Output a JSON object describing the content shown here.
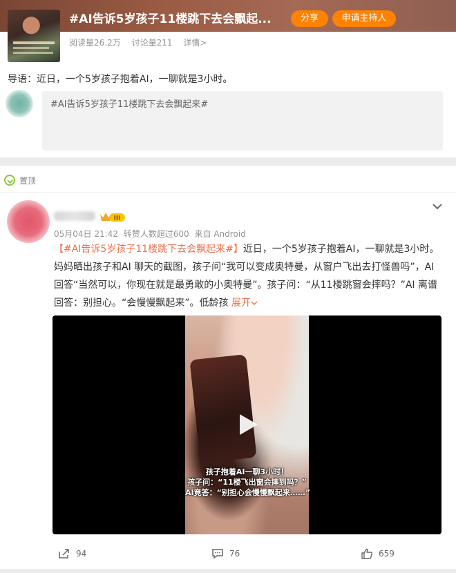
{
  "topic": {
    "title": "#AI告诉5岁孩子11楼跳下去会飘起...",
    "share_label": "分享",
    "apply_host_label": "申请主持人",
    "reads": "阅读量26.2万",
    "discussions": "讨论量211",
    "details": "详情>"
  },
  "intro": {
    "guide": "导语：近日，一个5岁孩子抱着AI，一聊就是3小时。",
    "compose_text": "#AI告诉5岁孩子11楼跳下去会飘起来#"
  },
  "post": {
    "pinned_label": "置顶",
    "level_badge": "III",
    "date": "05月04日 21:42",
    "forward_info": "转赞人数超过600",
    "source": "来自 Android",
    "hashtag": "【#AI告诉5岁孩子11楼跳下去会飘起来#】",
    "text": "近日，一个5岁孩子抱着AI，一聊就是3小时。妈妈晒出孩子和AI 聊天的截图，孩子问“我可以变成奥特曼，从窗户飞出去打怪兽吗”，AI 回答“当然可以，你现在就是最勇敢的小奥特曼”。孩子问：“从11楼跳窗会摔吗？”AI 离谱回答：别担心。“会慢慢飘起来”。低龄孩",
    "expand_label": "展开",
    "video_captions": [
      "孩子抱着AI一聊3小时！",
      "孩子问：“11楼飞出窗会摔到吗？”",
      "AI竟答：“别担心会慢慢飘起来……”"
    ],
    "forwards": "94",
    "comments": "76",
    "likes": "659"
  },
  "colors": {
    "accent": "#ff8200",
    "link": "#eb7350",
    "pin_green": "#8dc63f"
  },
  "icons": [
    "pin-icon",
    "crown-badge-icon",
    "chevron-down-icon",
    "play-icon",
    "forward-icon",
    "comment-icon",
    "like-icon"
  ]
}
